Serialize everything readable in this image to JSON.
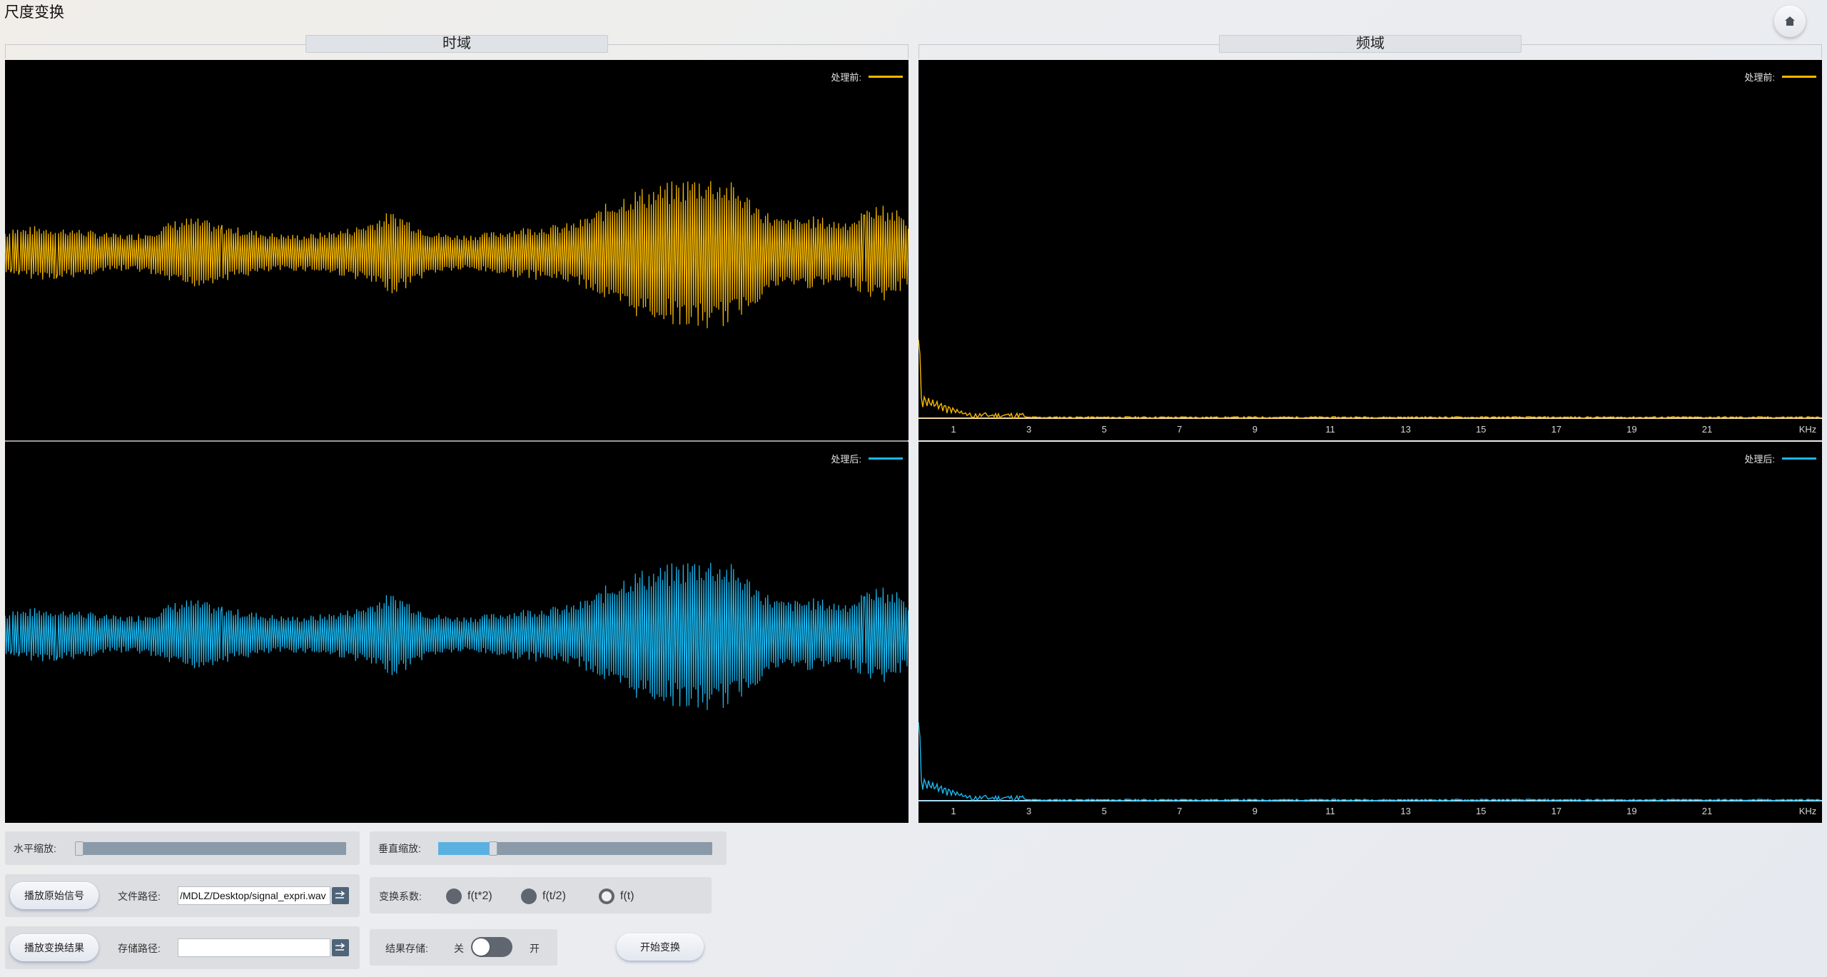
{
  "window": {
    "title": "尺度变换"
  },
  "home_button": {
    "icon": "home-icon"
  },
  "panels": {
    "time": {
      "header": "时域"
    },
    "freq": {
      "header": "频域"
    }
  },
  "legends": {
    "before": "处理前:",
    "after": "处理后:"
  },
  "freq_axis": {
    "ticks": [
      "1",
      "3",
      "5",
      "7",
      "9",
      "11",
      "13",
      "15",
      "17",
      "19",
      "21"
    ],
    "unit": "KHz"
  },
  "colors": {
    "before": "#f5b800",
    "after": "#1ab8f0",
    "plot_bg": "#000000",
    "accent": "#5ab1e1"
  },
  "controls": {
    "h_zoom": {
      "label": "水平缩放:",
      "value": 0.0
    },
    "v_zoom": {
      "label": "垂直缩放:",
      "value": 0.2
    },
    "play_original": "播放原始信号",
    "file_path": {
      "label": "文件路径:",
      "value": "/MDLZ/Desktop/signal_expri.wav"
    },
    "transform_coef": {
      "label": "变换系数:",
      "options": [
        "f(t*2)",
        "f(t/2)",
        "f(t)"
      ],
      "selected": "f(t)"
    },
    "play_result": "播放变换结果",
    "save_path": {
      "label": "存储路径:",
      "value": ""
    },
    "result_save": {
      "label": "结果存储:",
      "off": "关",
      "on": "开",
      "state": "off"
    },
    "start_transform": "开始变换"
  }
}
